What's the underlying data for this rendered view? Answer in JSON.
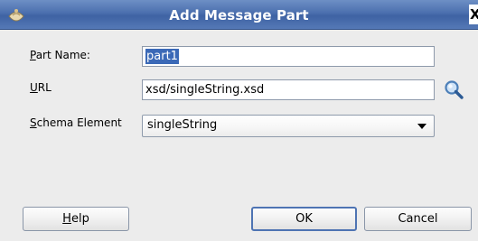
{
  "dialog": {
    "title": "Add Message Part",
    "close_glyph": "X"
  },
  "form": {
    "part_name": {
      "label_mnemonic": "P",
      "label_rest": "art Name:",
      "value": "part1"
    },
    "url": {
      "label_mnemonic": "U",
      "label_rest": "RL",
      "value": "xsd/singleString.xsd",
      "browse_icon": "search-icon"
    },
    "schema_element": {
      "label_mnemonic": "S",
      "label_rest": "chema Element",
      "selected": "singleString"
    }
  },
  "buttons": {
    "help_mnemonic": "H",
    "help_rest": "elp",
    "ok": "OK",
    "cancel": "Cancel"
  },
  "colors": {
    "title_bar": "#4b6fae",
    "selection": "#3b69b7",
    "dialog_bg": "#ececec",
    "default_button_border": "#4e74b3"
  }
}
